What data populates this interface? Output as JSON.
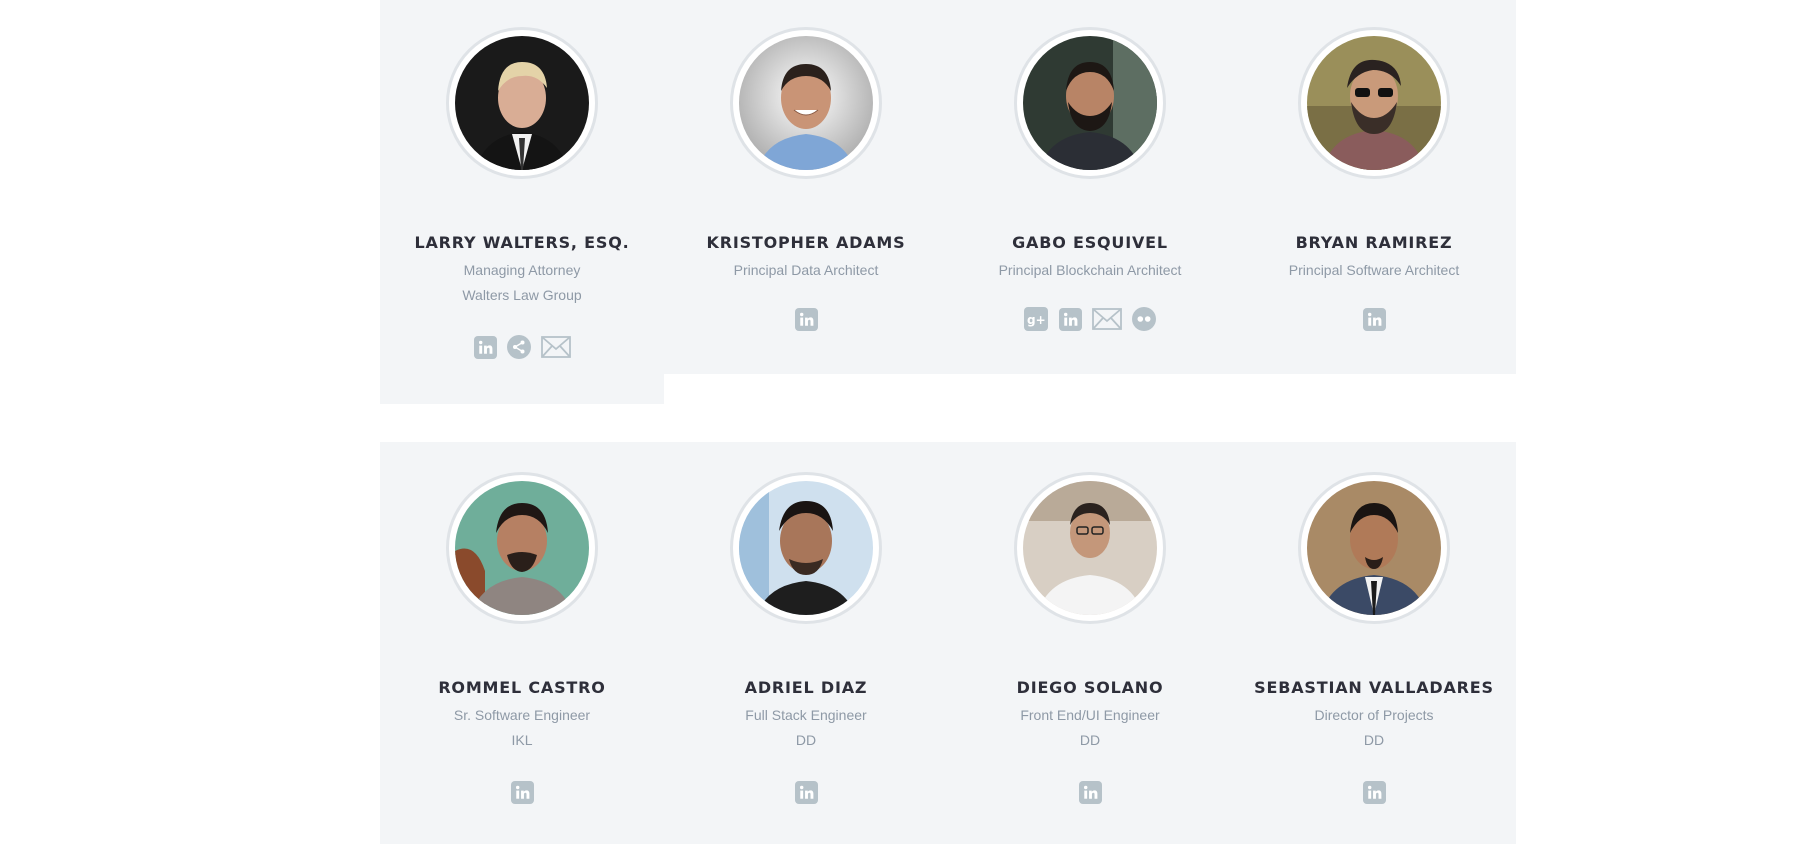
{
  "colors": {
    "card_bg": "#f3f5f7",
    "icon": "#b6c2c9",
    "name_text": "#2e2f3a",
    "role_text": "#8e99a6"
  },
  "team": [
    {
      "name": "LARRY WALTERS, ESQ.",
      "title": "Managing Attorney",
      "company": "Walters Law Group",
      "social_icons": [
        "linkedin-icon",
        "share-icon",
        "mail-icon"
      ]
    },
    {
      "name": "KRISTOPHER ADAMS",
      "title": "Principal Data Architect",
      "social_icons": [
        "linkedin-icon"
      ]
    },
    {
      "name": "GABO ESQUIVEL",
      "title": "Principal Blockchain Architect",
      "social_icons": [
        "google-plus-icon",
        "linkedin-icon",
        "mail-icon",
        "flickr-icon"
      ]
    },
    {
      "name": "BRYAN RAMIREZ",
      "title": "Principal Software Architect",
      "social_icons": [
        "linkedin-icon"
      ]
    },
    {
      "name": "ROMMEL CASTRO",
      "title": "Sr. Software Engineer",
      "company": "IKL",
      "social_icons": [
        "linkedin-icon"
      ]
    },
    {
      "name": "ADRIEL DIAZ",
      "title": "Full Stack Engineer",
      "company": "DD",
      "social_icons": [
        "linkedin-icon"
      ]
    },
    {
      "name": "DIEGO SOLANO",
      "title": "Front End/UI Engineer",
      "company": "DD",
      "social_icons": [
        "linkedin-icon"
      ]
    },
    {
      "name": "SEBASTIAN VALLADARES",
      "title": "Director of Projects",
      "company": "DD",
      "social_icons": [
        "linkedin-icon"
      ]
    }
  ]
}
